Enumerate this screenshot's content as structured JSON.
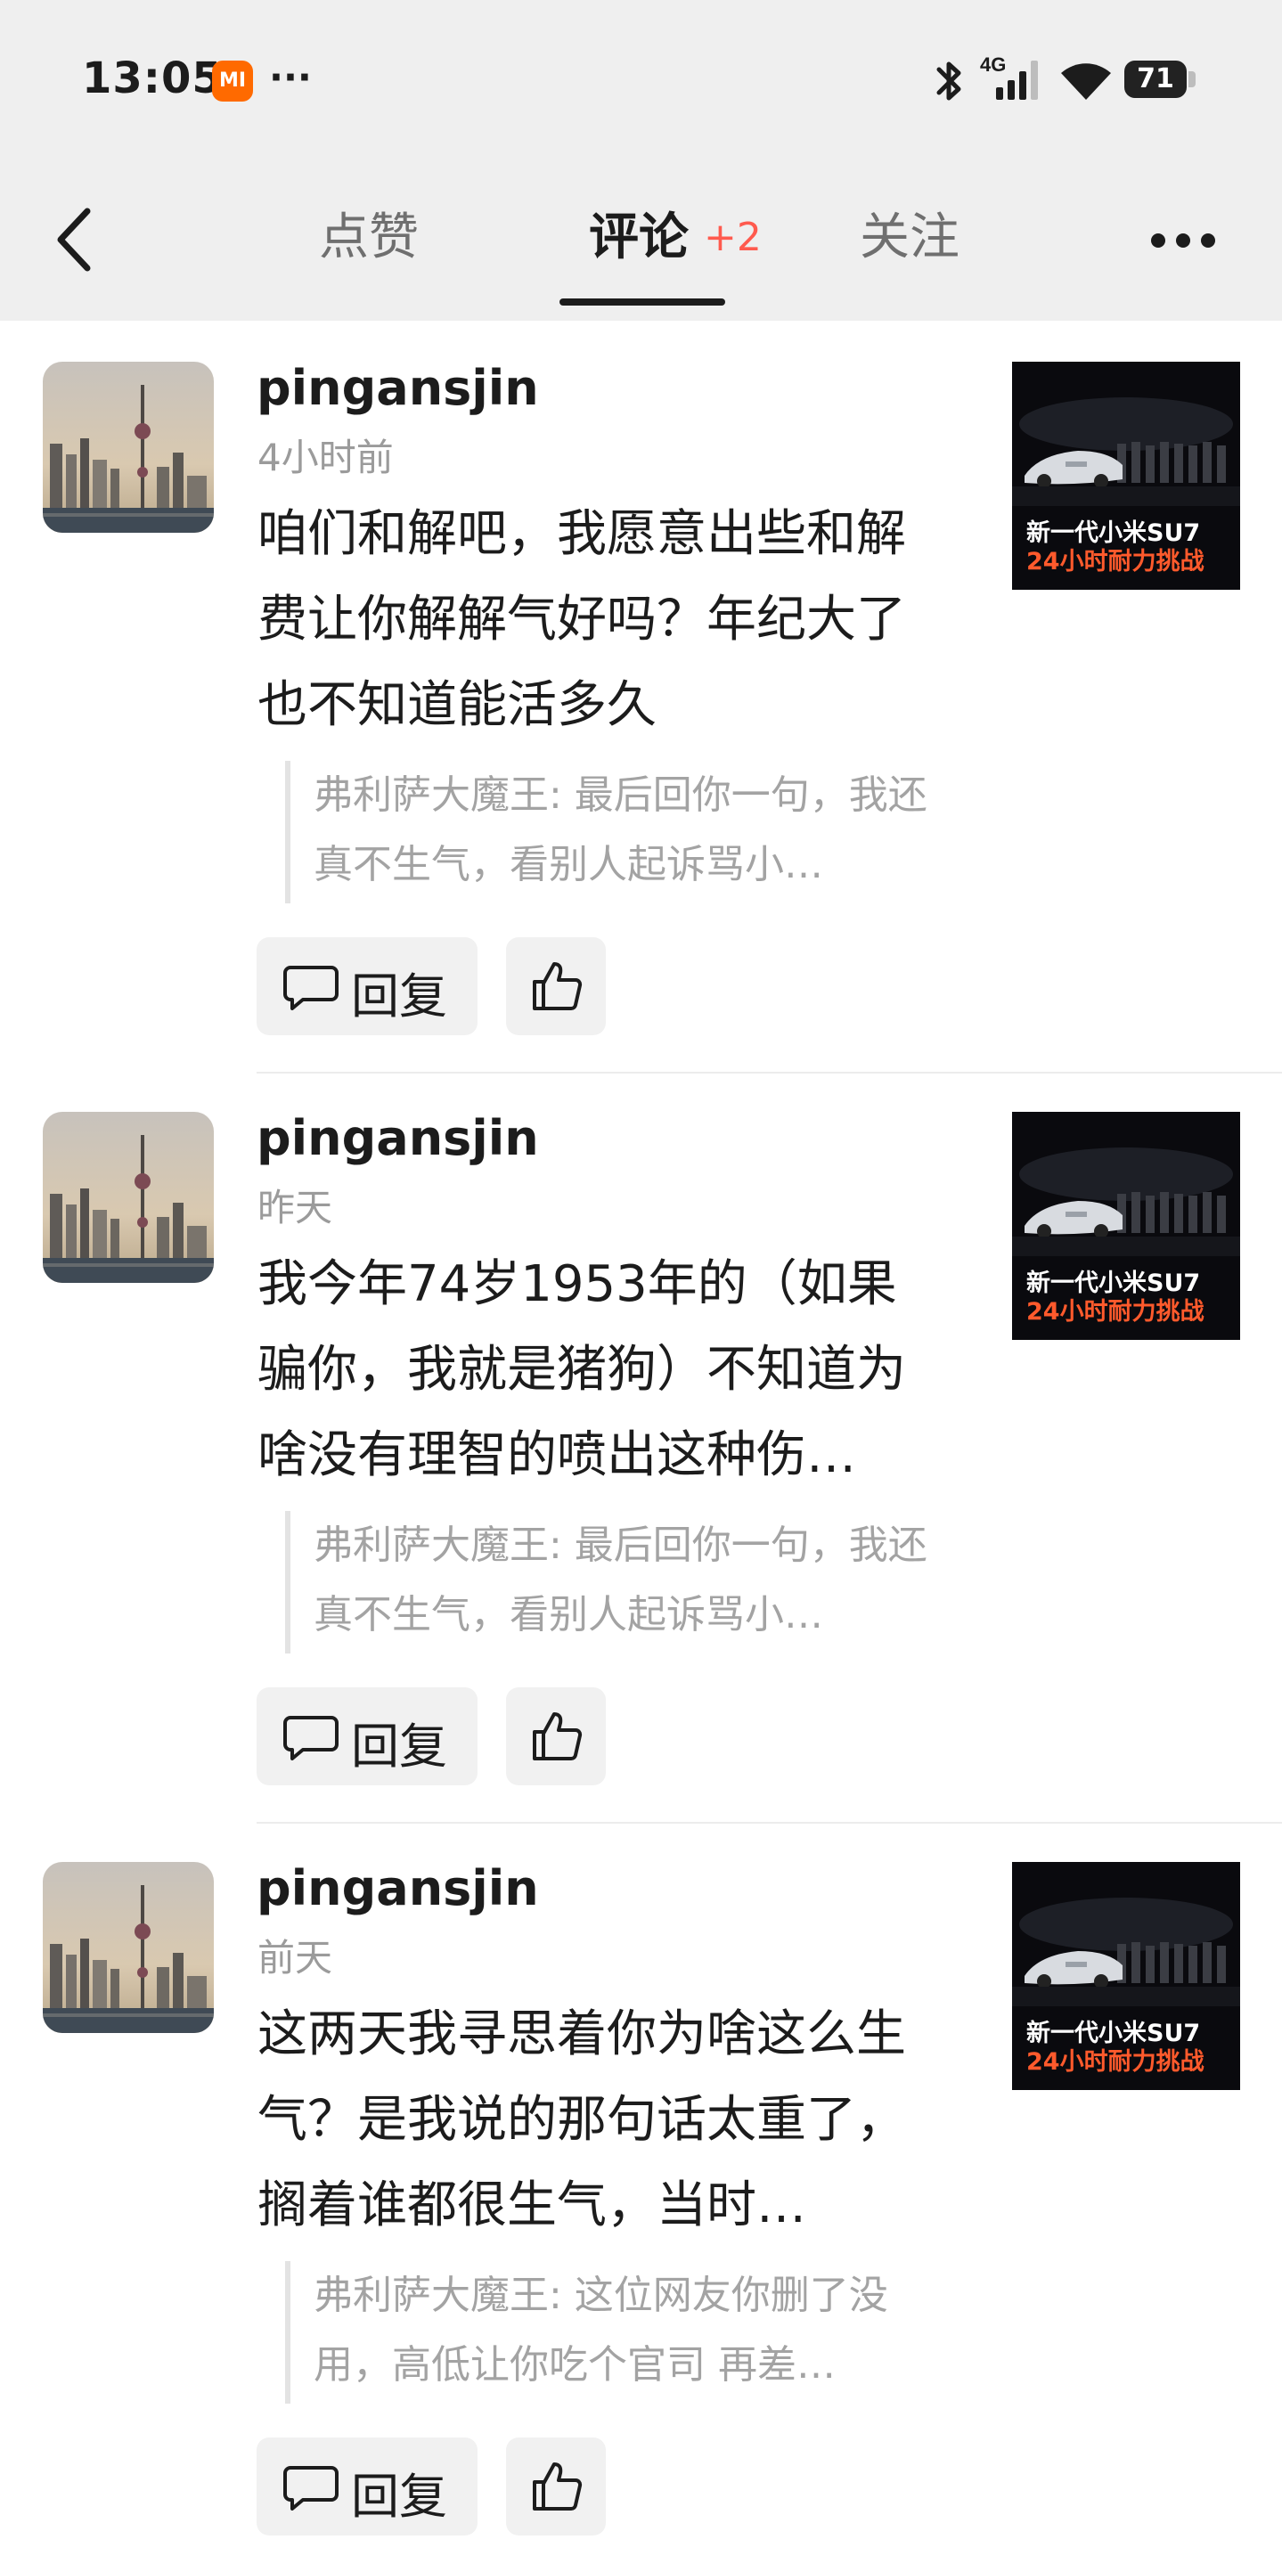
{
  "status_bar": {
    "time": "13:05",
    "app_badge": "MI",
    "more": "···",
    "network": "4G",
    "battery": "71"
  },
  "nav": {
    "tabs": [
      {
        "label": "点赞"
      },
      {
        "label": "评论"
      },
      {
        "label": "关注"
      }
    ],
    "comments_badge": "+2",
    "active_tab": "评论"
  },
  "comments": [
    {
      "username": "pingansjin",
      "time": "4小时前",
      "text": "咱们和解吧，我愿意出些和解费让你解解气好吗？年纪大了也不知道能活多久",
      "quote": "弗利萨大魔王: 最后回你一句，我还真不生气，看别人起诉骂小…",
      "reply_label": "回复",
      "thumb_line1": "新一代小米SU7",
      "thumb_line2": "24小时耐力挑战"
    },
    {
      "username": "pingansjin",
      "time": "昨天",
      "text": "我今年74岁1953年的（如果骗你，我就是猪狗）不知道为啥没有理智的喷出这种伤…",
      "quote": "弗利萨大魔王: 最后回你一句，我还真不生气，看别人起诉骂小…",
      "reply_label": "回复",
      "thumb_line1": "新一代小米SU7",
      "thumb_line2": "24小时耐力挑战"
    },
    {
      "username": "pingansjin",
      "time": "前天",
      "text": "这两天我寻思着你为啥这么生气？是我说的那句话太重了，搁着谁都很生气，当时…",
      "quote": "弗利萨大魔王: 这位网友你删了没用，高低让你吃个官司 再差…",
      "reply_label": "回复",
      "thumb_line1": "新一代小米SU7",
      "thumb_line2": "24小时耐力挑战"
    }
  ],
  "colors": {
    "header_bg": "#efefef",
    "badge_red": "#ff5a4e",
    "thumb_accent": "#ff5a2c",
    "muted_text": "#9b9b9b"
  },
  "icons": [
    "back-arrow-icon",
    "more-icon",
    "reply-bubble-icon",
    "thumbs-up-icon",
    "bluetooth-icon",
    "signal-icon",
    "wifi-icon",
    "battery-icon"
  ]
}
